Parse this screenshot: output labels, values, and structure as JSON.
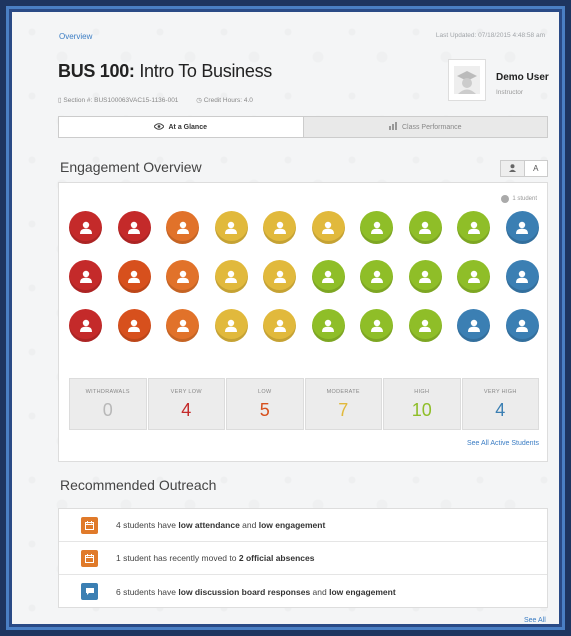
{
  "breadcrumb": {
    "overview": "Overview"
  },
  "last_updated": "Last Updated: 07/18/2015 4:48:58 am",
  "course": {
    "code": "BUS 100:",
    "name": "Intro To Business",
    "section": "Section #: BUS100063VAC15-1136-001",
    "credit_hours": "Credit Hours: 4.0"
  },
  "user": {
    "name": "Demo User",
    "role": "Instructor"
  },
  "tabs": [
    {
      "label": "At a Glance",
      "icon": "eye-icon",
      "active": true
    },
    {
      "label": "Class Performance",
      "icon": "bar-chart-icon",
      "active": false
    }
  ],
  "engagement": {
    "title": "Engagement Overview",
    "view_toggle": [
      "user-icon",
      "A"
    ],
    "legend": "1 student",
    "colors": {
      "red": "#c42a2a",
      "dkorange": "#d7501d",
      "orange": "#e1722a",
      "yellow": "#e1b93c",
      "green": "#8fbe28",
      "blue": "#3b7fb3"
    },
    "grid": [
      [
        "red",
        "red",
        "orange",
        "yellow",
        "yellow",
        "yellow",
        "green",
        "green",
        "green",
        "blue"
      ],
      [
        "red",
        "dkorange",
        "orange",
        "yellow",
        "yellow",
        "green",
        "green",
        "green",
        "green",
        "blue"
      ],
      [
        "red",
        "dkorange",
        "orange",
        "yellow",
        "yellow",
        "green",
        "green",
        "green",
        "blue",
        "blue"
      ]
    ],
    "stats": [
      {
        "label": "Withdrawals",
        "value": "0",
        "color": "#b8b8b8"
      },
      {
        "label": "Very Low",
        "value": "4",
        "color": "#c42a2a"
      },
      {
        "label": "Low",
        "value": "5",
        "color": "#d7501d"
      },
      {
        "label": "Moderate",
        "value": "7",
        "color": "#e1b93c"
      },
      {
        "label": "High",
        "value": "10",
        "color": "#8fbe28"
      },
      {
        "label": "Very High",
        "value": "4",
        "color": "#3b7fb3"
      }
    ],
    "see_active": "See All Active Students"
  },
  "outreach": {
    "title": "Recommended Outreach",
    "items": [
      {
        "icon": "calendar-icon",
        "color": "orange",
        "pre": "4 students have ",
        "b1": "low attendance",
        "mid": " and ",
        "b2": "low engagement",
        "post": ""
      },
      {
        "icon": "calendar-icon",
        "color": "orange",
        "pre": "1 student has recently moved to ",
        "b1": "2 official absences",
        "mid": "",
        "b2": "",
        "post": ""
      },
      {
        "icon": "chat-icon",
        "color": "blue",
        "pre": "6 students have ",
        "b1": "low discussion board responses",
        "mid": " and ",
        "b2": "low engagement",
        "post": ""
      }
    ],
    "see_all": "See All"
  }
}
